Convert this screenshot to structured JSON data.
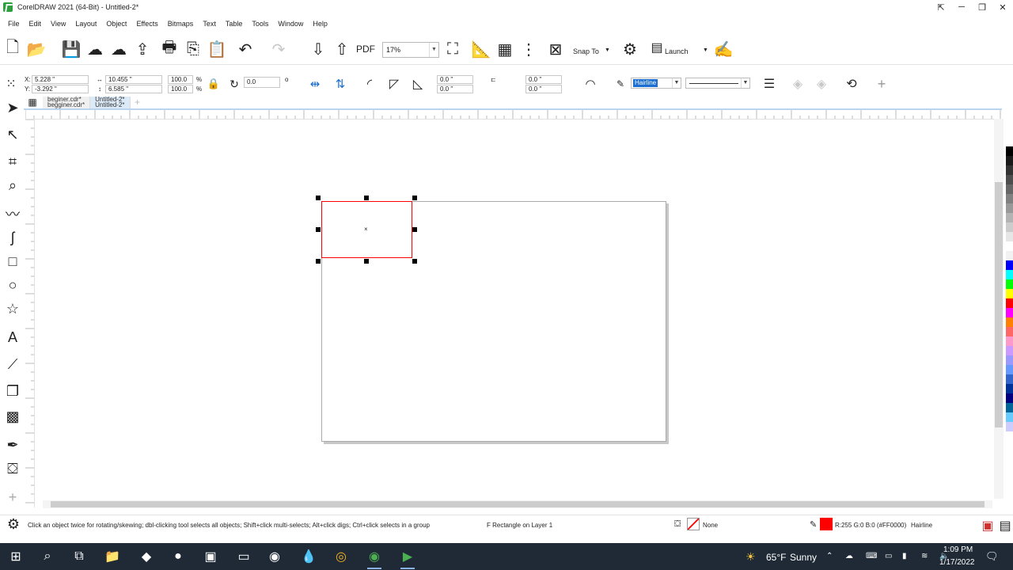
{
  "window": {
    "title": "CorelDRAW 2021 (64-Bit) - Untitled-2*",
    "minimize": "─",
    "restore": "❐",
    "close": "✕"
  },
  "menu": [
    "File",
    "Edit",
    "View",
    "Layout",
    "Object",
    "Effects",
    "Bitmaps",
    "Text",
    "Table",
    "Tools",
    "Window",
    "Help"
  ],
  "toolbar": {
    "zoom_value": "17%",
    "snap_label": "Snap To",
    "launch_label": "Launch"
  },
  "property_bar": {
    "x_label": "X:",
    "x_value": "5.228 \"",
    "y_label": "Y:",
    "y_value": "-3.292 \"",
    "width_value": "10.455 \"",
    "height_value": "6.585 \"",
    "scale_w": "100.0",
    "scale_h": "100.0",
    "percent": "%",
    "rotation": "0.0",
    "degree": "o",
    "corner_1": "0.0 \"",
    "corner_2": "0.0 \"",
    "corner_3": "0.0 \"",
    "corner_4": "0.0 \"",
    "outline_width": "Hairline"
  },
  "doc_tabs": [
    {
      "line1": "beginer.cdr*",
      "line2": "begginer.cdr*"
    },
    {
      "line1": "Untitled-2*",
      "line2": "Untitled-2*"
    }
  ],
  "status": {
    "hint": "Click an object twice for rotating/skewing; dbl-clicking tool selects all objects; Shift+click multi-selects; Alt+click digs; Ctrl+click selects in a group",
    "object_info": "F Rectangle on Layer 1",
    "fill_none": "None",
    "outline_color": "R:255 G:0 B:0 (#FF0000)",
    "outline_width": "Hairline"
  },
  "taskbar": {
    "weather_temp": "65°F",
    "weather_text": "Sunny",
    "time": "1:09 PM",
    "date": "1/17/2022"
  },
  "palette_colors": [
    "#000000",
    "#1a1a1a",
    "#333333",
    "#4d4d4d",
    "#666666",
    "#808080",
    "#999999",
    "#b3b3b3",
    "#cccccc",
    "#e6e6e6",
    "#ffffff",
    "#f2f2f2",
    "#0000ff",
    "#00ffff",
    "#00ff00",
    "#ffff00",
    "#ff0000",
    "#ff00ff",
    "#ff8000",
    "#ff6666",
    "#ff99cc",
    "#cc99ff",
    "#9999ff",
    "#6699ff",
    "#3366cc",
    "#003399",
    "#000080",
    "#006699",
    "#66ccff",
    "#ccccff"
  ],
  "colors": {
    "selection_outline": "#ff0000",
    "accent": "#1a6fd0",
    "taskbar_bg": "#1f2a36"
  }
}
